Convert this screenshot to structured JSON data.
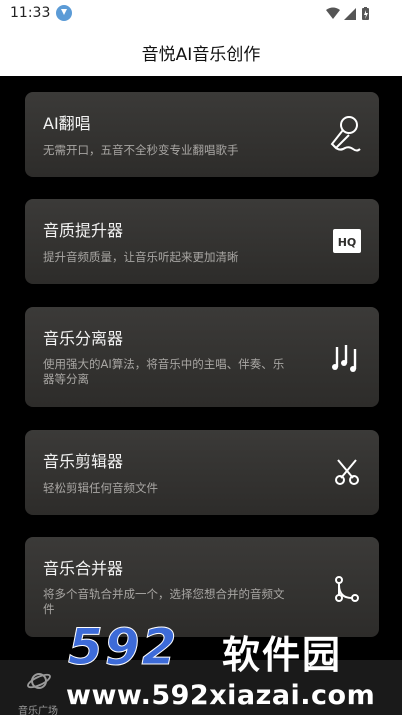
{
  "status_bar": {
    "time": "11:33",
    "download_icon": "download-circle-icon",
    "icons": [
      "wifi-icon",
      "signal-icon",
      "battery-icon"
    ]
  },
  "header": {
    "title": "音悦AI音乐创作"
  },
  "cards": [
    {
      "title": "AI翻唱",
      "desc": "无需开口，五音不全秒变专业翻唱歌手",
      "icon": "microphone-icon"
    },
    {
      "title": "音质提升器",
      "desc": "提升音频质量，让音乐听起来更加清晰",
      "icon": "hq-icon",
      "icon_text": "HQ"
    },
    {
      "title": "音乐分离器",
      "desc": "使用强大的AI算法，将音乐中的主唱、伴奏、乐器等分离",
      "icon": "equalizer-icon"
    },
    {
      "title": "音乐剪辑器",
      "desc": "轻松剪辑任何音频文件",
      "icon": "scissors-icon"
    },
    {
      "title": "音乐合并器",
      "desc": "将多个音轨合并成一个，选择您想合并的音频文件",
      "icon": "merge-icon"
    }
  ],
  "bottom_nav": {
    "items": [
      {
        "label": "音乐广场",
        "icon": "planet-icon"
      }
    ]
  },
  "watermark": {
    "number": "592",
    "name": "软件园",
    "url": "www.592xiazai.com"
  },
  "colors": {
    "accent_blue": "#3d6bd8",
    "card_bg": "#353432",
    "background": "#000000"
  }
}
